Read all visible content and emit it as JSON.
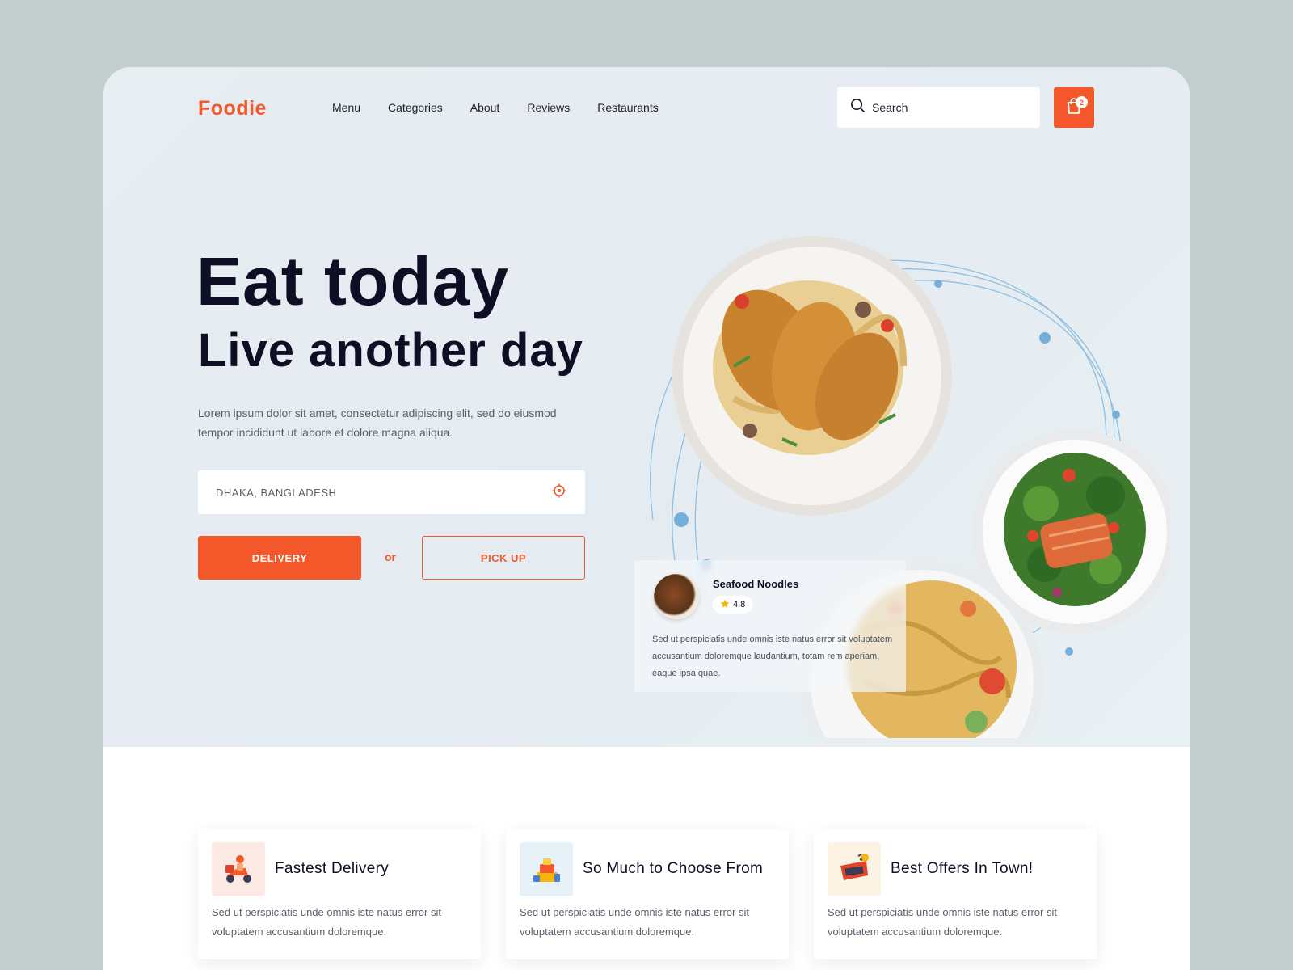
{
  "header": {
    "logo": "Foodie",
    "nav": [
      "Menu",
      "Categories",
      "About",
      "Reviews",
      "Restaurants"
    ],
    "search_placeholder": "Search",
    "cart_count": "2"
  },
  "hero": {
    "headline": "Eat today",
    "subheadline": "Live another day",
    "lead": "Lorem ipsum dolor sit amet, consectetur adipiscing elit, sed do eiusmod tempor incididunt ut labore et dolore magna aliqua.",
    "location_value": "DHAKA, BANGLADESH",
    "delivery_label": "DELIVERY",
    "or_label": "or",
    "pickup_label": "PICK UP"
  },
  "food_card": {
    "title": "Seafood Noodles",
    "rating": "4.8",
    "description": "Sed ut perspiciatis unde omnis iste natus error sit voluptatem accusantium doloremque laudantium, totam rem aperiam, eaque ipsa quae."
  },
  "features": [
    {
      "title": "Fastest  Delivery",
      "description": "Sed ut perspiciatis unde omnis iste natus error sit voluptatem accusantium doloremque.",
      "icon": "scooter-icon",
      "tint": "#fde9e4"
    },
    {
      "title": "So Much to Choose From",
      "description": "Sed ut perspiciatis unde omnis iste natus error sit voluptatem accusantium doloremque.",
      "icon": "food-stack-icon",
      "tint": "#e6f1f8"
    },
    {
      "title": "Best Offers In Town!",
      "description": "Sed ut perspiciatis unde omnis iste natus error sit voluptatem accusantium doloremque.",
      "icon": "special-offer-icon",
      "tint": "#fdf3e4"
    }
  ],
  "colors": {
    "accent": "#f4582a",
    "dark_text": "#0e0e24",
    "orbit_blue": "#7fb3d8"
  }
}
